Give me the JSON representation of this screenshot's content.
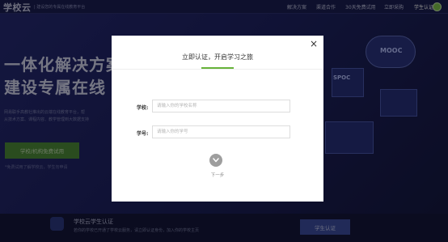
{
  "header": {
    "logo": "学校云",
    "logo_sub": "| 建设您的专属在线教育平台",
    "nav": [
      "解决方案",
      "渠道合作",
      "30天免费试用",
      "立即采购",
      "学生认证"
    ]
  },
  "hero": {
    "title_line1": "一体化解决方案",
    "title_line2": "建设专属在线",
    "desc_line1": "网易联手高教社推出的云端在线教育平台，帮",
    "desc_line2": "从技术方案、课程内容、教学管理到大数据支持",
    "trial_button": "学校/机构免费试用",
    "trial_note": "*免费试用了解学校云，学生勿申请",
    "badge_mooc": "MOOC",
    "badge_spoc": "SPOC"
  },
  "footer": {
    "title": "学校云学生认证",
    "subtitle": "若你的学校已开通了学校云服务，请立即认证身份，加入你的学校主页",
    "button": "学生认证"
  },
  "modal": {
    "title": "立即认证，开启学习之旅",
    "close": "×",
    "school_label": "学校:",
    "school_placeholder": "请输入你的学校名称",
    "student_id_label": "学号:",
    "student_id_placeholder": "请输入你的学号",
    "next_label": "下一步"
  },
  "colors": {
    "accent_green": "#67b33a",
    "next_button_gray": "#9e9e9e"
  },
  "icons": [
    "close-icon",
    "chevron-down-icon",
    "user-avatar-icon"
  ]
}
